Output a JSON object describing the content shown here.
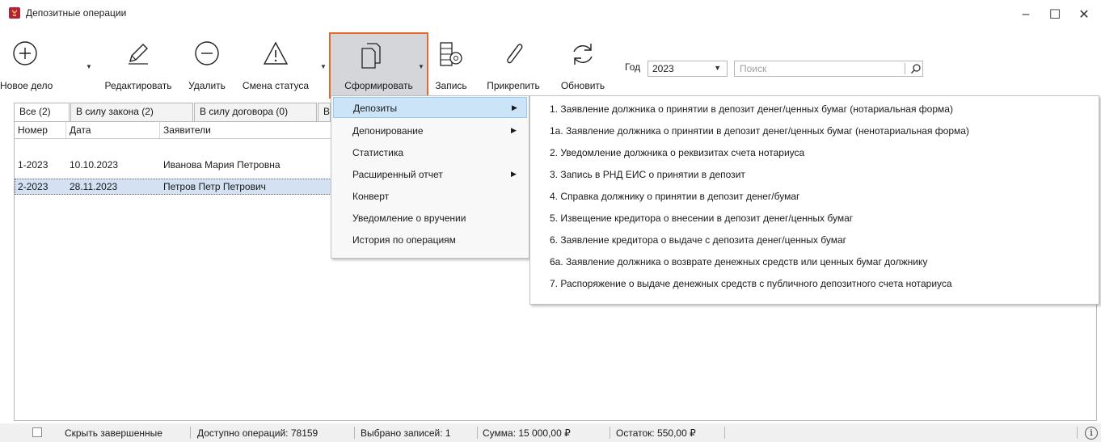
{
  "window": {
    "title": "Депозитные операции",
    "controls": {
      "minimize": "–",
      "maximize": "☐",
      "close": "✕"
    }
  },
  "toolbar": {
    "new_case": "Новое дело",
    "edit": "Редактировать",
    "delete": "Удалить",
    "change_status": "Смена статуса",
    "generate": "Сформировать",
    "record": "Запись",
    "attach": "Прикрепить",
    "refresh": "Обновить",
    "icons": [
      "plus-circle-icon",
      "pencil-icon",
      "minus-circle-icon",
      "warning-icon",
      "copy-icon",
      "film-icon",
      "paperclip-icon",
      "refresh-icon"
    ]
  },
  "filters": {
    "year_label": "Год",
    "year_value": "2023",
    "search_placeholder": "Поиск"
  },
  "tabs": [
    "Все (2)",
    "В силу закона (2)",
    "В силу договора (0)",
    "В б"
  ],
  "grid": {
    "columns": [
      "Номер",
      "Дата",
      "Заявители"
    ],
    "rows": [
      {
        "number": "1-2023",
        "date": "10.10.2023",
        "applicants": "Иванова Мария Петровна"
      },
      {
        "number": "2-2023",
        "date": "28.11.2023",
        "applicants": "Петров Петр Петрович"
      }
    ],
    "selected_row": 1
  },
  "menu": {
    "items": [
      {
        "label": "Депозиты",
        "submenu": true
      },
      {
        "label": "Депонирование",
        "submenu": true
      },
      {
        "label": "Статистика",
        "submenu": false
      },
      {
        "label": "Расширенный отчет",
        "submenu": true
      },
      {
        "label": "Конверт",
        "submenu": false
      },
      {
        "label": "Уведомление о вручении",
        "submenu": false
      },
      {
        "label": "История по операциям",
        "submenu": false
      }
    ],
    "highlighted": 0
  },
  "submenu": {
    "items": [
      "1. Заявление должника о принятии в депозит денег/ценных бумаг (нотариальная форма)",
      "1а. Заявление должника о принятии в депозит денег/ценных бумаг (ненотариальная форма)",
      "2. Уведомление должника о реквизитах счета нотариуса",
      "3. Запись в РНД ЕИС о принятии в депозит",
      "4. Справка должнику о принятии в депозит денег/бумаг",
      "5. Извещение кредитора о внесении в депозит денег/ценных бумаг",
      "6. Заявление кредитора о выдаче с депозита денег/ценных бумаг",
      "6а. Заявление должника о возврате денежных средств или ценных бумаг должнику",
      "7. Распоряжение о выдаче денежных средств с публичного депозитного счета нотариуса"
    ]
  },
  "status": {
    "hide_completed": "Скрыть завершенные",
    "available": "Доступно операций: 78159",
    "selected": "Выбрано записей: 1",
    "sum": "Сумма: 15 000,00 ₽",
    "remainder": "Остаток: 550,00 ₽",
    "info_icon": "i"
  },
  "colors": {
    "highlight_border": "#e8672c",
    "selection": "#d3e1f2",
    "menu_highlight": "#cce4f7",
    "app_icon": "#b5213a"
  }
}
